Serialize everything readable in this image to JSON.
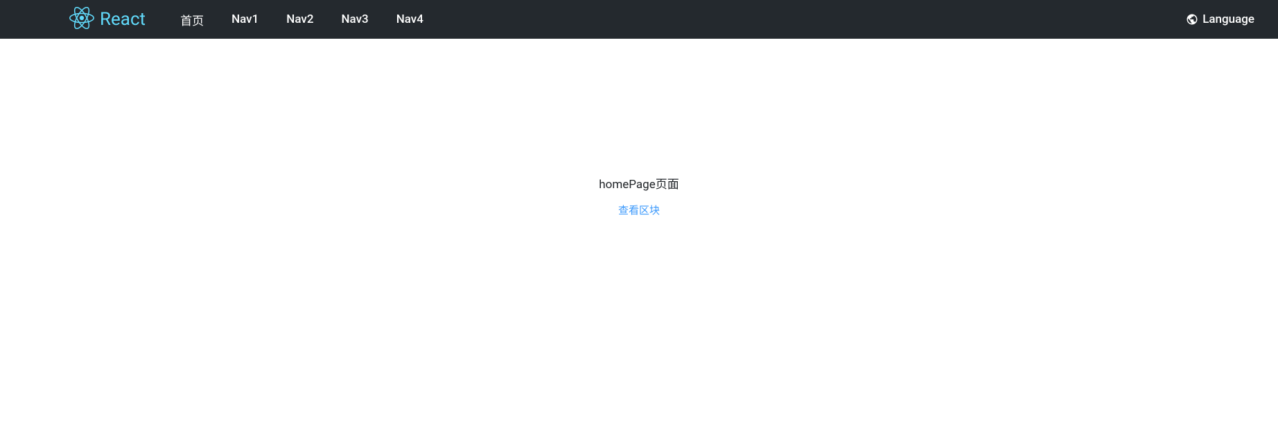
{
  "brand": {
    "text": "React"
  },
  "nav": {
    "items": [
      {
        "label": "首页"
      },
      {
        "label": "Nav1"
      },
      {
        "label": "Nav2"
      },
      {
        "label": "Nav3"
      },
      {
        "label": "Nav4"
      }
    ]
  },
  "language": {
    "label": "Language"
  },
  "main": {
    "title": "homePage页面",
    "link_label": "查看区块"
  }
}
